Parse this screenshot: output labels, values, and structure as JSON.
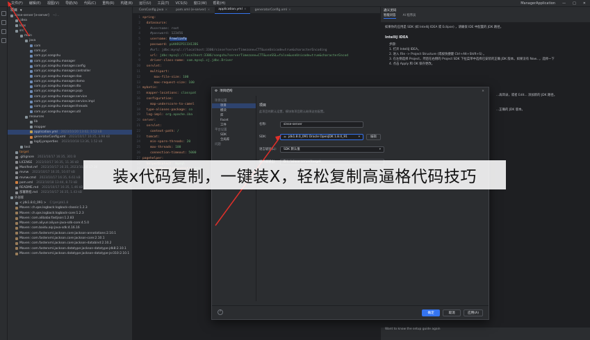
{
  "menubar": {
    "items": [
      "文件(F)",
      "编辑(E)",
      "视图(V)",
      "导航(N)",
      "代码(C)",
      "重构(R)",
      "构建(B)",
      "运行(U)",
      "工具(T)",
      "VCS(S)",
      "窗口(W)",
      "帮助(H)"
    ],
    "window_title": "ManagerApplication"
  },
  "project": {
    "header": "项目",
    "tree": [
      {
        "label": "sinse-server [e-server]",
        "meta": "~/...",
        "icon": "folder-icon",
        "indent": 0
      },
      {
        "label": ".idea",
        "meta": "",
        "icon": "folder-icon",
        "indent": 1
      },
      {
        "label": "logs",
        "meta": "",
        "icon": "folder-icon",
        "indent": 1
      },
      {
        "label": "src",
        "meta": "",
        "icon": "folder-icon",
        "indent": 1
      },
      {
        "label": "main",
        "meta": "",
        "icon": "folder-icon",
        "indent": 2
      },
      {
        "label": "java",
        "meta": "",
        "icon": "folder-icon",
        "indent": 3
      },
      {
        "label": "com",
        "meta": "",
        "icon": "package-icon",
        "indent": 4
      },
      {
        "label": "com.yyc",
        "meta": "",
        "icon": "package-icon",
        "indent": 4
      },
      {
        "label": "com.yyc.songshu",
        "meta": "",
        "icon": "package-icon",
        "indent": 4
      },
      {
        "label": "com.yyc.songshu.manager",
        "meta": "",
        "icon": "package-icon",
        "indent": 4
      },
      {
        "label": "com.yyc.songshu.manager.config",
        "meta": "",
        "icon": "package-icon",
        "indent": 4
      },
      {
        "label": "com.yyc.songshu.manager.controller",
        "meta": "",
        "icon": "package-icon",
        "indent": 4
      },
      {
        "label": "com.yyc.songshu.manager.dao",
        "meta": "",
        "icon": "package-icon",
        "indent": 4
      },
      {
        "label": "com.yyc.songshu.manager.domo",
        "meta": "",
        "icon": "package-icon",
        "indent": 4
      },
      {
        "label": "com.yyc.songshu.manager.dto",
        "meta": "",
        "icon": "package-icon",
        "indent": 4
      },
      {
        "label": "com.yyc.songshu.manager.pojo",
        "meta": "",
        "icon": "package-icon",
        "indent": 4
      },
      {
        "label": "com.yyc.songshu.manager.service",
        "meta": "",
        "icon": "package-icon",
        "indent": 4
      },
      {
        "label": "com.yyc.songshu.manager.service.impl",
        "meta": "",
        "icon": "package-icon",
        "indent": 4
      },
      {
        "label": "com.yyc.songshu.manager.threads",
        "meta": "",
        "icon": "package-icon",
        "indent": 4
      },
      {
        "label": "com.yyc.songshu.manager.util",
        "meta": "",
        "icon": "package-icon",
        "indent": 4
      },
      {
        "label": "resources",
        "meta": "",
        "icon": "folder-icon",
        "indent": 3
      },
      {
        "label": "lib",
        "meta": "",
        "icon": "folder-icon",
        "indent": 4
      },
      {
        "label": "mapper",
        "meta": "",
        "icon": "folder-icon",
        "indent": 4
      },
      {
        "label": "application.yml",
        "meta": "2023/10/20 13:02, 3.52 kB",
        "icon": "yaml-file-icon",
        "indent": 4,
        "selected": true
      },
      {
        "label": "generatorConfig.xml",
        "meta": "2023/10/17 16:35, 3.98 kB",
        "icon": "xml-file-icon",
        "indent": 4
      },
      {
        "label": "log4j.properties",
        "meta": "2023/10/18 13:36, 1.52 kB",
        "icon": "file-icon",
        "indent": 4
      },
      {
        "label": "test",
        "meta": "",
        "icon": "folder-icon",
        "indent": 2
      },
      {
        "label": "target",
        "meta": "",
        "icon": "folder-icon",
        "indent": 1,
        "target": true
      },
      {
        "label": ".gitignore",
        "meta": "2023/10/17 16:35, 301 B",
        "icon": "file-icon",
        "indent": 1
      },
      {
        "label": "LICENSE",
        "meta": "2023/10/17 16:35, 11.36 kB",
        "icon": "file-icon",
        "indent": 1
      },
      {
        "label": "Manifest.mf",
        "meta": "2023/10/17 16:35, 2023/10/18 17:36",
        "icon": "file-icon",
        "indent": 1
      },
      {
        "label": "mvnw",
        "meta": "2023/10/17 16:35, 10.07 kB",
        "icon": "file-icon",
        "indent": 1
      },
      {
        "label": "mvnw.cmd",
        "meta": "2023/10/17 16:35, 6.61 kB",
        "icon": "file-icon",
        "indent": 1
      },
      {
        "label": "pom.xml",
        "meta": "2023/10/18 13:44, 8.73 kB",
        "icon": "xml-file-icon",
        "indent": 1
      },
      {
        "label": "README.md",
        "meta": "2023/10/17 16:35, 1.46 kB",
        "icon": "file-icon",
        "indent": 1
      },
      {
        "label": "部署教程.md",
        "meta": "2023/10/17 16:35, 1.43 kB",
        "icon": "file-icon",
        "indent": 1
      },
      {
        "label": "外部库",
        "meta": "",
        "icon": "library-icon",
        "indent": 0
      },
      {
        "label": "< jdk1.8.0_091 >",
        "meta": "C:\\jre\\jdk1.8",
        "icon": "folder-icon",
        "indent": 1
      },
      {
        "label": "Maven: ch.qos.logback:logback-classic:1.2.3",
        "meta": "",
        "icon": "jar-icon",
        "indent": 1
      },
      {
        "label": "Maven: ch.qos.logback:logback-core:1.2.3",
        "meta": "",
        "icon": "jar-icon",
        "indent": 1
      },
      {
        "label": "Maven: com.alibaba:fastjson:1.2.83",
        "meta": "",
        "icon": "jar-icon",
        "indent": 1
      },
      {
        "label": "Maven: com.aliyun:aliyun-java-sdk-core:4.5.0",
        "meta": "",
        "icon": "jar-icon",
        "indent": 1
      },
      {
        "label": "Maven: com.baidu.aip:java-sdk:4.16.16",
        "meta": "",
        "icon": "jar-icon",
        "indent": 1
      },
      {
        "label": "Maven: com.fasterxml.jackson.core:jackson-annotations:2.10.1",
        "meta": "",
        "icon": "jar-icon",
        "indent": 1
      },
      {
        "label": "Maven: com.fasterxml.jackson.core:jackson-core:2.10.1",
        "meta": "",
        "icon": "jar-icon",
        "indent": 1
      },
      {
        "label": "Maven: com.fasterxml.jackson.core:jackson-databind:2.10.2",
        "meta": "",
        "icon": "jar-icon",
        "indent": 1
      },
      {
        "label": "Maven: com.fasterxml.jackson.datatype:jackson-datatype-jdk8:2.10.1",
        "meta": "",
        "icon": "jar-icon",
        "indent": 1
      },
      {
        "label": "Maven: com.fasterxml.jackson.datatype:jackson-datatype-jsr310:2.10.1",
        "meta": "",
        "icon": "jar-icon",
        "indent": 1
      }
    ]
  },
  "editor": {
    "tabs": [
      {
        "label": "CorsConfig.java",
        "active": false
      },
      {
        "label": "pom.xml (e-server)",
        "active": false
      },
      {
        "label": "application.yml",
        "active": true
      },
      {
        "label": "generatorConfig.xml",
        "active": false
      }
    ],
    "lines": [
      {
        "n": "1",
        "html": "<span class='k'>spring:</span>"
      },
      {
        "n": "2",
        "html": "  <span class='k'>datasource:</span>"
      },
      {
        "n": "3",
        "html": "    <span class='c'>#username: root</span>"
      },
      {
        "n": "4",
        "html": "    <span class='c'>#password: 123456</span>"
      },
      {
        "n": "5",
        "html": "    <span class='k'>username:</span> <span class='hl'>Freelinfo</span>"
      },
      {
        "n": "6",
        "html": "    <span class='k'>password:</span> <span class='v'>pLKKRIPICCHIJBS</span>"
      },
      {
        "n": "7",
        "html": "    <span class='c'>#url: jdbc:mysql://localhost:3306/sinse?serverTimezone=CTT&useUnicode=true&characterEncoding</span>"
      },
      {
        "n": "8",
        "html": "    <span class='k'>url:</span> <span class='v'>jdbc:mysql://localhost:3306/songshu?serverTimezone=CTT&useSSL=false&useUnicode=true&characterEncod</span>"
      },
      {
        "n": "9",
        "html": "    <span class='k'>driver-class-name:</span> <span class='v'>com.mysql.cj.jdbc.Driver</span>"
      },
      {
        "n": "10",
        "html": "  <span class='k'>servlet:</span>"
      },
      {
        "n": "11",
        "html": "    <span class='k'>multipart:</span>"
      },
      {
        "n": "12",
        "html": "      <span class='k'>max-file-size:</span> <span class='v'>100</span>"
      },
      {
        "n": "13",
        "html": "      <span class='k'>max-request-size:</span> <span class='v'>100</span>"
      },
      {
        "n": "14",
        "html": "<span class='k'>mybatis:</span>"
      },
      {
        "n": "15",
        "html": "  <span class='k'>mapper-locations:</span> <span class='v'>classpat</span>"
      },
      {
        "n": "16",
        "html": "  <span class='k'>configuration:</span>"
      },
      {
        "n": "17",
        "html": "    <span class='k'>map-underscore-to-camel</span>"
      },
      {
        "n": "18",
        "html": "  <span class='k'>type-aliases-package:</span> <span class='v'>co</span>"
      },
      {
        "n": "19",
        "html": "  <span class='k'>log-impl:</span> <span class='v'>org.apache.iba</span>"
      },
      {
        "n": "20",
        "html": "<span class='k'>server:</span>"
      },
      {
        "n": "21",
        "html": "  <span class='k'>servlet:</span>"
      },
      {
        "n": "22",
        "html": "    <span class='k'>context-path:</span> <span class='v'>/</span>"
      },
      {
        "n": "23",
        "html": "  <span class='k'>tomcat:</span>"
      },
      {
        "n": "24",
        "html": "    <span class='k'>min-spare-threads:</span> <span class='v'>20</span>"
      },
      {
        "n": "25",
        "html": "    <span class='k'>max-threads:</span> <span class='v'>100</span>"
      },
      {
        "n": "26",
        "html": "    <span class='k'>connection-timeout:</span> <span class='v'>5000</span>"
      },
      {
        "n": "27",
        "html": "<span class='k'>pagehelper:</span>"
      },
      {
        "n": "28",
        "html": "  <span class='k'>helperDialect:</span> <span class='v'>mysql</span>"
      },
      {
        "n": "29",
        "html": "  <span class='k'>supportMethodsArguments:</span> <span class='v'>true</span>"
      },
      {
        "n": "30",
        "html": "  <span class='k'>reasonable:</span> <span class='v'>true</span>"
      }
    ]
  },
  "side": {
    "header": "通义灵码",
    "tabs": [
      "智能问答",
      "AI 程序员"
    ],
    "intro": "如果你的应用是 SDK (如 IntelliJ IDEA 或 Eclipse) ，请确保 IDE 中配置的 JDK 路径。",
    "section_title": "IntelliJ IDEA",
    "steps_label": "步骤:",
    "steps": [
      "1. 打开 IntelliJ IDEA。",
      "2. 进入 File -> Project Structure (或按快捷键 Ctrl+Alt+Shift+S) 。",
      "3. 在左侧选择 Project，然后在右侧的 Project SDK 下拉菜单中选择已安装的正确 JDK 版本。如果没有 Now...，选择一下",
      "4. 点击 Apply 和 OK 保存更改。"
    ],
    "mid_a": "...再目录，或者 Edit... 添加新的 JDK 路径。",
    "mid_b": "...正确的 JDK 版本。",
    "footer": "Want to know the setup guide again"
  },
  "dialog": {
    "title": "项目结构",
    "close": "×",
    "nav": [
      {
        "label": "项目设置",
        "header": true
      },
      {
        "label": "项目",
        "header": false,
        "selected": true
      },
      {
        "label": "模块",
        "header": false
      },
      {
        "label": "库",
        "header": false
      },
      {
        "label": "Facet",
        "header": false
      },
      {
        "label": "工件",
        "header": false
      },
      {
        "label": "平台设置",
        "header": true
      },
      {
        "label": "SDK",
        "header": false
      },
      {
        "label": "全局库",
        "header": false
      },
      {
        "label": "问题",
        "header": true
      }
    ],
    "section": "项目",
    "subtitle": "此项目的默认设置，模块和项目默认继承这些配置。",
    "name_label": "名称:",
    "name_value": "sinse-server",
    "sdk_label": "SDK:",
    "sdk_value": "jdk1.8.0_091  Oracle OpenJDK 1.8.0_91",
    "sdk_edit": "编辑",
    "lang_label": "语言级别(L):",
    "lang_value": "SDK 默认值",
    "out_label": "编译器输出:",
    "out_value": "D:\\...\\sinse-server\\target",
    "ok": "确定",
    "cancel": "取消",
    "apply": "应用(A)",
    "help": "?"
  },
  "watermark": {
    "text": "装x代码复制，一键装X，轻松复制高逼格代码技巧"
  },
  "colors": {
    "accent": "#3574f0",
    "annotation_red": "#e0302a",
    "bg": "#1e1f22",
    "panel": "#2b2d30"
  }
}
